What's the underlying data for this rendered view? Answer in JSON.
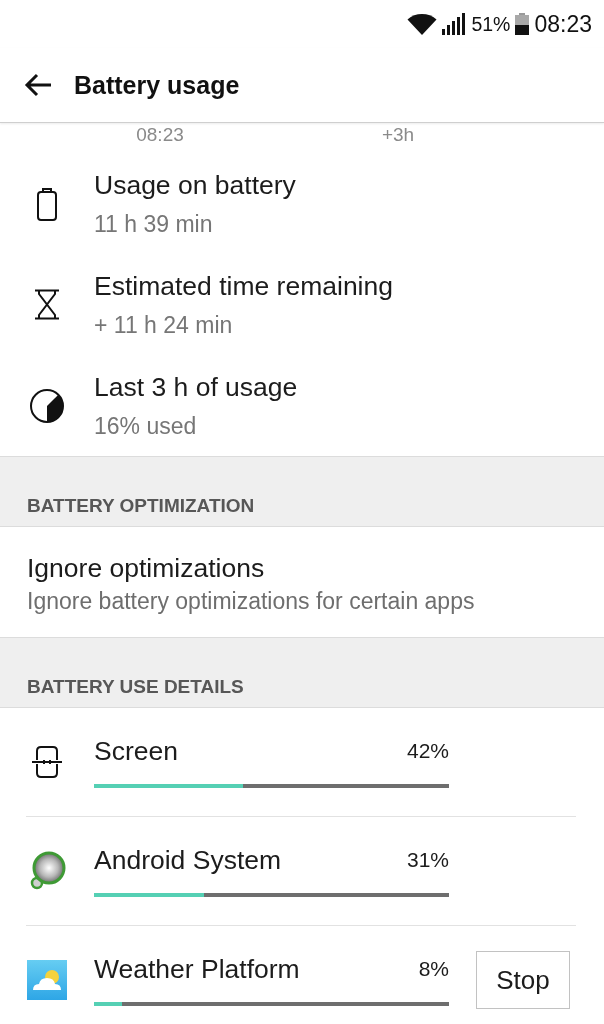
{
  "status_bar": {
    "battery_percent": "51%",
    "time": "08:23"
  },
  "app_bar": {
    "title": "Battery usage"
  },
  "chart_axis": {
    "labels": [
      "08:23",
      "+3h"
    ]
  },
  "summary": [
    {
      "kind": "battery",
      "title": "Usage on battery",
      "value": "11 h 39 min"
    },
    {
      "kind": "hourglass",
      "title": "Estimated time remaining",
      "value": "+ 11 h 24 min"
    },
    {
      "kind": "pie",
      "title": "Last 3 h of usage",
      "value": "16% used"
    }
  ],
  "optimization_section": {
    "header": "BATTERY OPTIMIZATION",
    "title": "Ignore optimizations",
    "subtitle": "Ignore battery optimizations for certain apps"
  },
  "details_section": {
    "header": "BATTERY USE DETAILS",
    "apps": [
      {
        "kind": "screen",
        "name": "Screen",
        "percent": "42%",
        "level": 0.42
      },
      {
        "kind": "android",
        "name": "Android System",
        "percent": "31%",
        "level": 0.31
      },
      {
        "kind": "weather",
        "name": "Weather Platform",
        "percent": "8%",
        "level": 0.08,
        "button": "Stop"
      }
    ]
  }
}
